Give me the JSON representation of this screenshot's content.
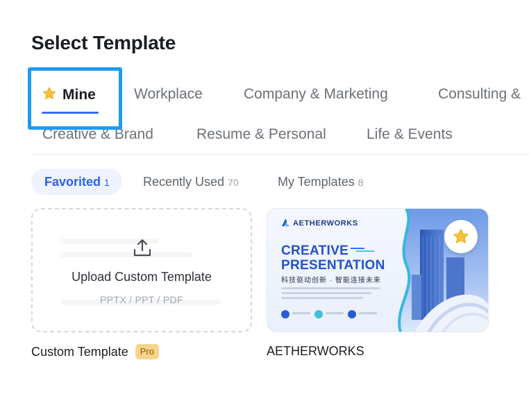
{
  "page": {
    "title": "Select Template"
  },
  "category_tabs": [
    {
      "label": "Mine",
      "icon": "star-icon",
      "active": true
    },
    {
      "label": "Workplace"
    },
    {
      "label": "Company & Marketing"
    },
    {
      "label": "Consulting &"
    },
    {
      "label": "Creative & Brand"
    },
    {
      "label": "Resume & Personal"
    },
    {
      "label": "Life & Events"
    }
  ],
  "sub_tabs": [
    {
      "label": "Favorited",
      "count": "1",
      "active": true
    },
    {
      "label": "Recently Used",
      "count": "70"
    },
    {
      "label": "My Templates",
      "count": "8"
    }
  ],
  "upload_card": {
    "icon": "upload-icon",
    "title": "Upload Custom Template",
    "formats": "PPTX / PPT / PDF",
    "caption": "Custom Template",
    "badge": "Pro"
  },
  "template_card": {
    "brand": "AETHERWORKS",
    "headline_1": "CREATIVE",
    "headline_2": "PRESENTATION",
    "subtitle_cn": "科技驱动创新 · 智能连接未来",
    "caption": "AETHERWORKS",
    "favorited": true,
    "favorite_icon": "star-icon"
  },
  "colors": {
    "accent": "#3a6ee8",
    "focus_ring": "#1e9bf0",
    "star": "#f7c23a",
    "pro_badge": "#f8d48d"
  }
}
